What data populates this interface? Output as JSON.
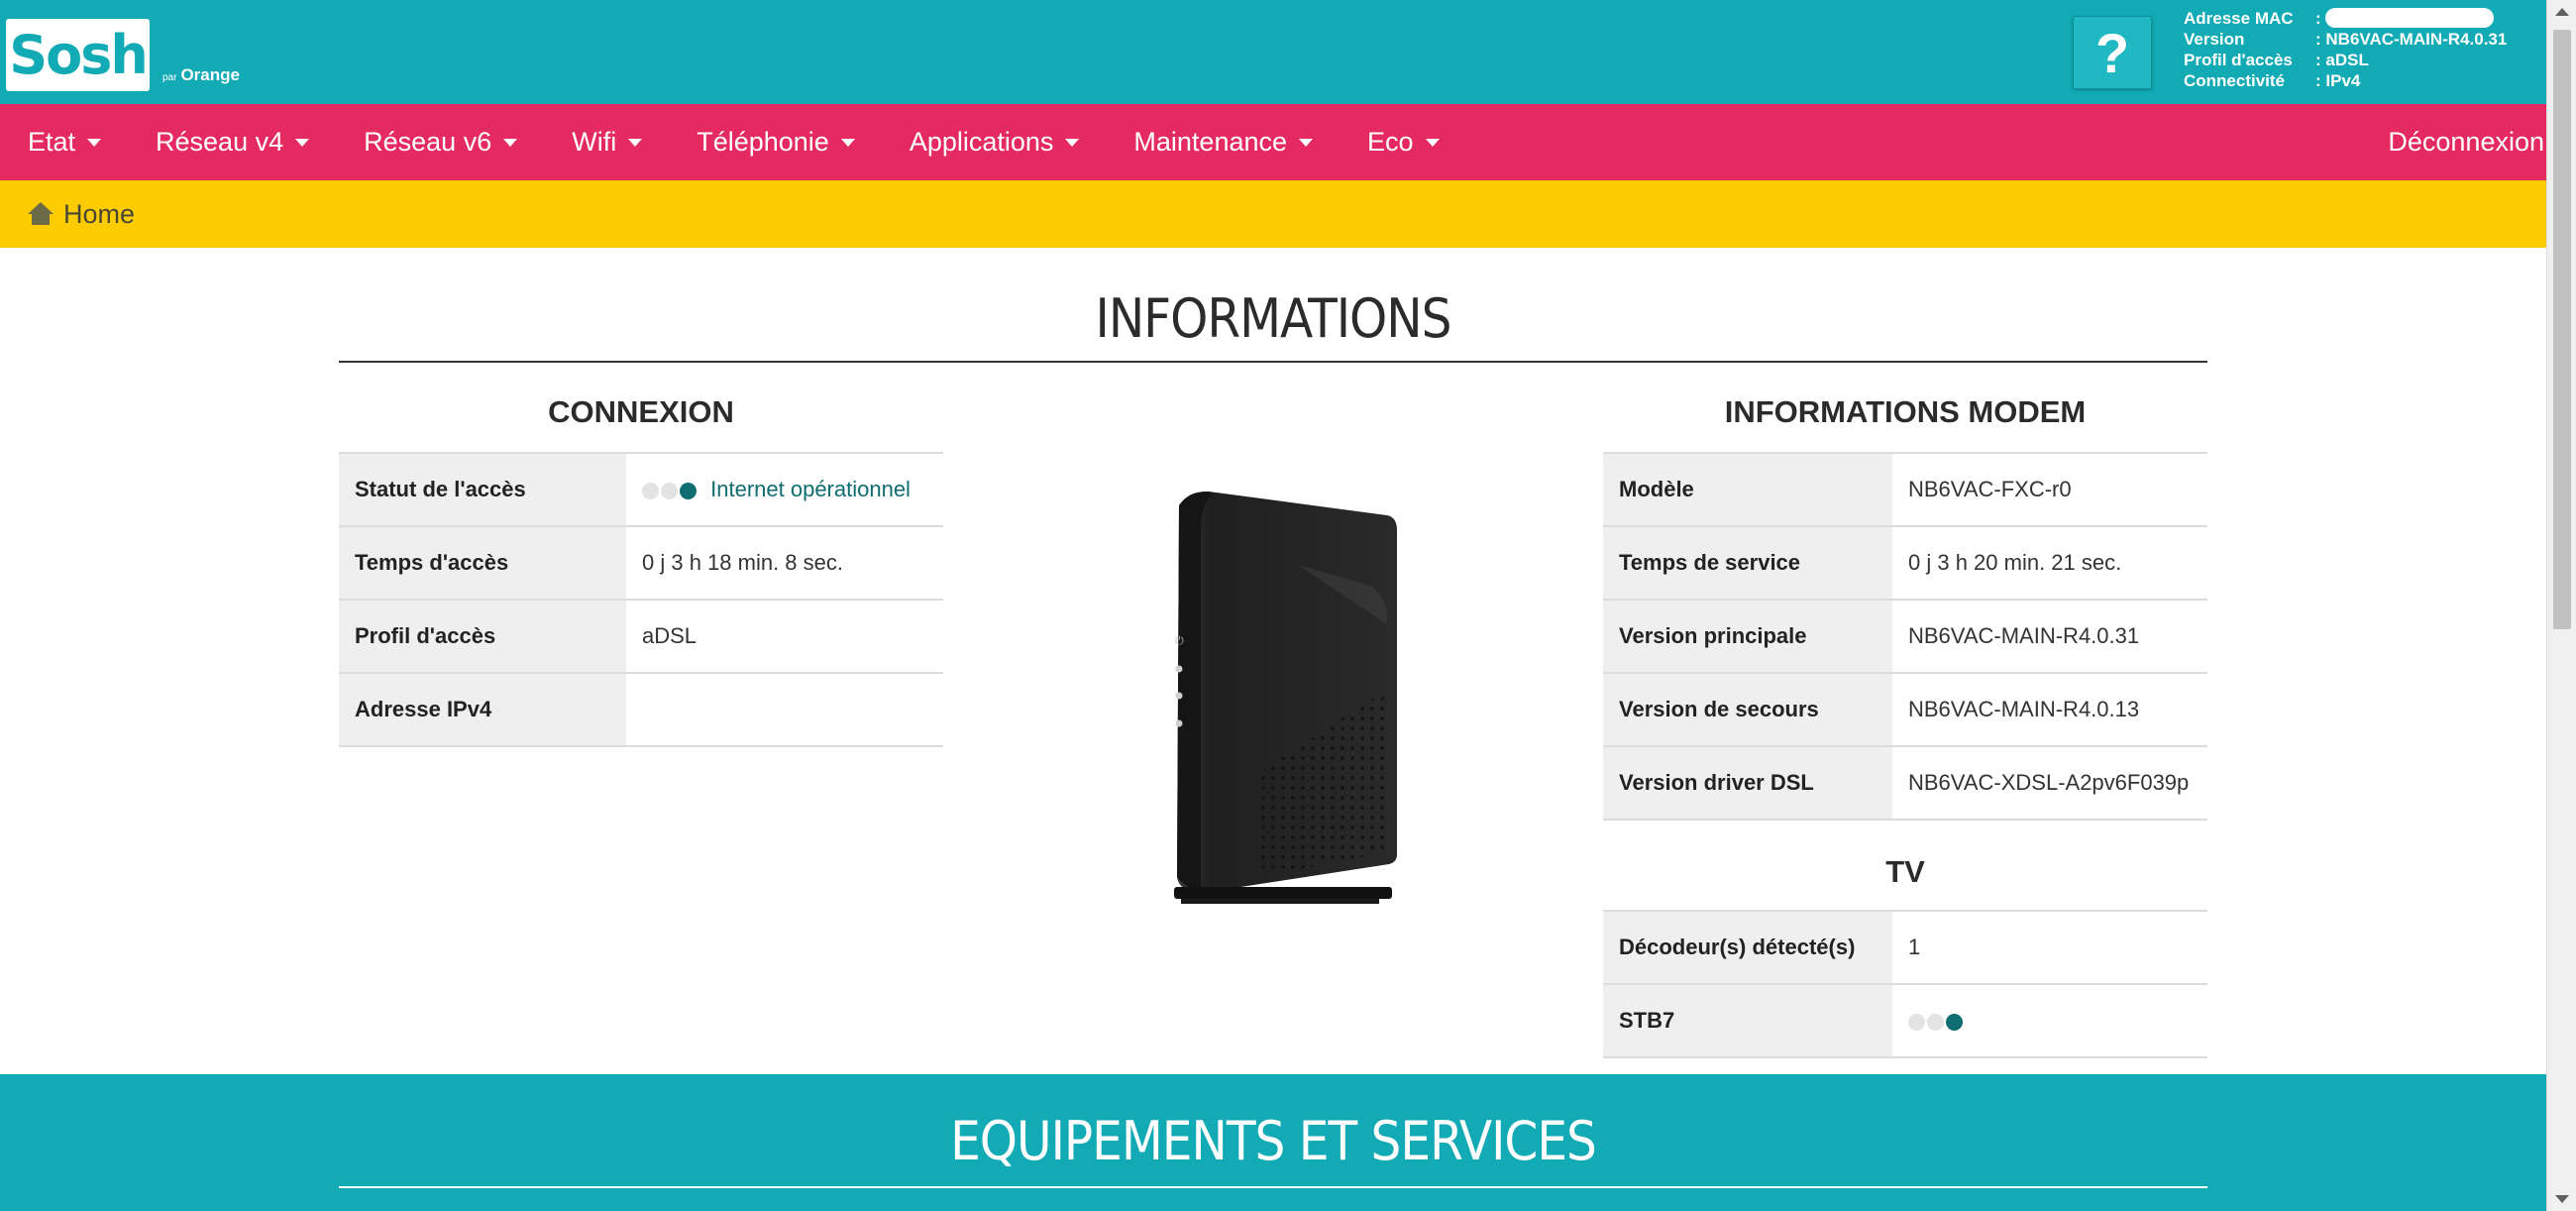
{
  "header": {
    "logo_text": "Sosh",
    "logo_sub_par": "par",
    "logo_sub_brand": "Orange",
    "help_label": "?",
    "info": [
      {
        "key": "Adresse MAC",
        "value": ":"
      },
      {
        "key": "Version",
        "value": ": NB6VAC-MAIN-R4.0.31"
      },
      {
        "key": "Profil d'accès",
        "value": ": aDSL"
      },
      {
        "key": "Connectivité",
        "value": ": IPv4"
      }
    ]
  },
  "nav": {
    "items": [
      {
        "label": "Etat"
      },
      {
        "label": "Réseau v4"
      },
      {
        "label": "Réseau v6"
      },
      {
        "label": "Wifi"
      },
      {
        "label": "Téléphonie"
      },
      {
        "label": "Applications"
      },
      {
        "label": "Maintenance"
      },
      {
        "label": "Eco"
      }
    ],
    "logout": "Déconnexion"
  },
  "breadcrumb": {
    "home": "Home"
  },
  "main": {
    "title": "INFORMATIONS",
    "connexion": {
      "title": "CONNEXION",
      "rows": [
        {
          "key": "Statut de l'accès",
          "value": "Internet opérationnel"
        },
        {
          "key": "Temps d'accès",
          "value": "0 j 3 h 18 min. 8 sec."
        },
        {
          "key": "Profil d'accès",
          "value": "aDSL"
        },
        {
          "key": "Adresse IPv4",
          "value": ""
        }
      ]
    },
    "modem": {
      "title": "INFORMATIONS MODEM",
      "rows": [
        {
          "key": "Modèle",
          "value": "NB6VAC-FXC-r0"
        },
        {
          "key": "Temps de service",
          "value": "0 j 3 h 20 min. 21 sec."
        },
        {
          "key": "Version principale",
          "value": "NB6VAC-MAIN-R4.0.31"
        },
        {
          "key": "Version de secours",
          "value": "NB6VAC-MAIN-R4.0.13"
        },
        {
          "key": "Version driver DSL",
          "value": "NB6VAC-XDSL-A2pv6F039p"
        }
      ]
    },
    "tv": {
      "title": "TV",
      "rows": [
        {
          "key": "Décodeur(s) détecté(s)",
          "value": "1"
        },
        {
          "key": "STB7",
          "value": ""
        }
      ]
    }
  },
  "services": {
    "title": "EQUIPEMENTS ET SERVICES"
  },
  "colors": {
    "teal": "#12aab5",
    "pink": "#e42a61",
    "yellow": "#fccc00",
    "led_on": "#0f6c70",
    "led_off": "#e3e3e3"
  },
  "icons": {
    "help": "question-mark-icon",
    "home": "home-icon",
    "dropdown": "caret-down-icon",
    "status_leds": "status-led-icon"
  }
}
